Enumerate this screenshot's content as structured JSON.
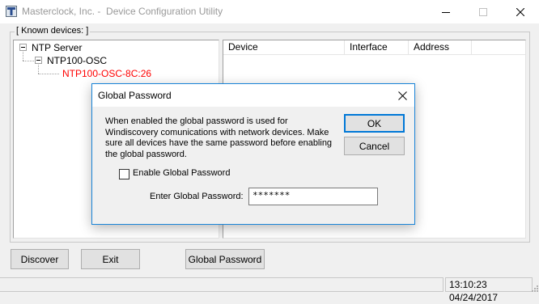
{
  "window": {
    "title": "Masterclock, Inc. -  Device Configuration Utility",
    "icon": "masterclock-app-icon"
  },
  "known_devices": {
    "label": "[ Known devices: ]",
    "tree": [
      {
        "label": "NTP Server",
        "level": 0,
        "expanded": true,
        "selected": false
      },
      {
        "label": "NTP100-OSC",
        "level": 1,
        "expanded": true,
        "selected": false
      },
      {
        "label": "NTP100-OSC-8C:26",
        "level": 2,
        "expanded": false,
        "selected": true
      }
    ],
    "columns": [
      "Device",
      "Interface",
      "Address"
    ]
  },
  "buttons": {
    "discover": "Discover",
    "exit": "Exit",
    "global_password": "Global Password"
  },
  "status": {
    "left_text": "",
    "timestamp": "13:10:23 04/24/2017"
  },
  "dialog": {
    "title": "Global Password",
    "message": "When enabled the global password is used for Windiscovery comunications with network devices. Make sure all devices have the same password before enabling the global password.",
    "ok_label": "OK",
    "cancel_label": "Cancel",
    "enable_label": "Enable Global Password",
    "enable_checked": false,
    "password_label": "Enter Global Password:",
    "password_value": "*******"
  },
  "colors": {
    "selected_text": "#ff0000",
    "dialog_border": "#1883d7",
    "default_button_border": "#0078d7"
  }
}
